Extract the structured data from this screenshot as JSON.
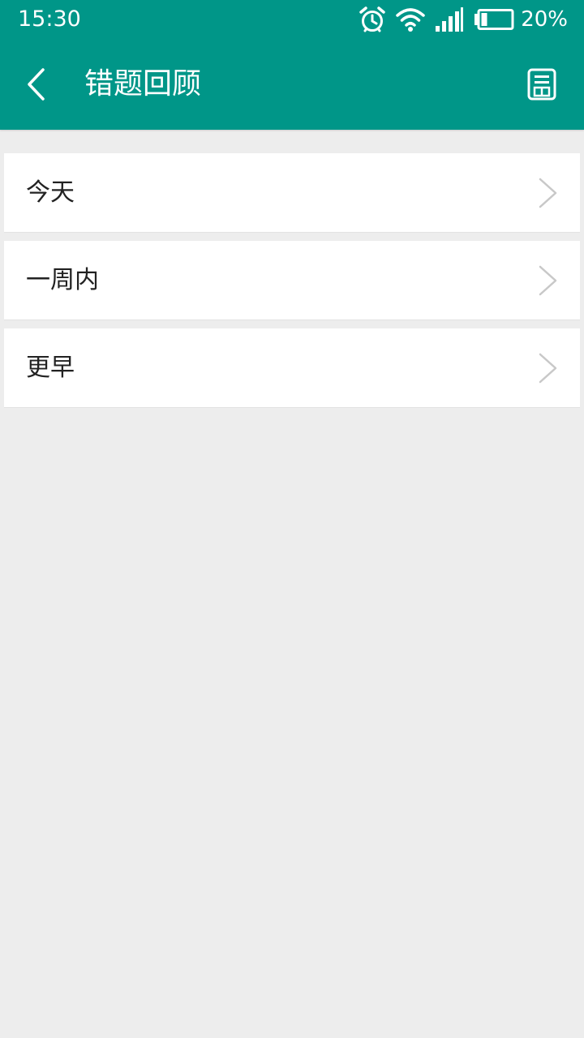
{
  "status_bar": {
    "time": "15:30",
    "battery_percent": "20%",
    "battery_level": 0.2,
    "icons": [
      "alarm-icon",
      "wifi-icon",
      "signal-icon",
      "battery-icon"
    ]
  },
  "appbar": {
    "title": "错题回顾",
    "back_icon": "back-arrow-icon",
    "action_icon": "save-icon"
  },
  "list": {
    "items": [
      {
        "label": "今天"
      },
      {
        "label": "一周内"
      },
      {
        "label": "更早"
      }
    ]
  },
  "colors": {
    "primary": "#009688",
    "background": "#ededed",
    "card": "#ffffff",
    "chevron": "#c8c8c8",
    "text": "#222222"
  }
}
